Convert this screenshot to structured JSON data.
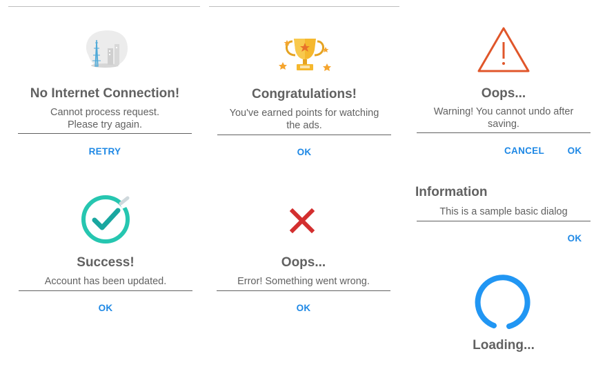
{
  "dialogs": {
    "no_internet": {
      "title": "No Internet Connection!",
      "message_line1": "Cannot process request.",
      "message_line2": "Please try again.",
      "button": "RETRY"
    },
    "congrats": {
      "title": "Congratulations!",
      "message_line1": "You've earned points for watching",
      "message_line2": "the ads.",
      "button": "OK"
    },
    "warning": {
      "title": "Oops...",
      "message_line1": "Warning! You cannot undo after",
      "message_line2": "saving.",
      "cancel": "CANCEL",
      "ok": "OK"
    },
    "success": {
      "title": "Success!",
      "message": "Account has been updated.",
      "button": "OK"
    },
    "error": {
      "title": "Oops...",
      "message": "Error! Something went wrong.",
      "button": "OK"
    },
    "info": {
      "title": "Information",
      "message": "This is a sample basic dialog",
      "button": "OK"
    },
    "loading": {
      "title": "Loading..."
    }
  },
  "colors": {
    "accent": "#1e88e5",
    "warning": "#e0562a",
    "error": "#d32f2f",
    "success": "#26c6b0",
    "loading": "#2196f3",
    "trophy": "#f5b82e"
  },
  "icons": [
    "no-signal-illustration-icon",
    "trophy-icon",
    "warning-triangle-icon",
    "success-check-icon",
    "error-x-icon",
    "loading-spinner-icon"
  ]
}
